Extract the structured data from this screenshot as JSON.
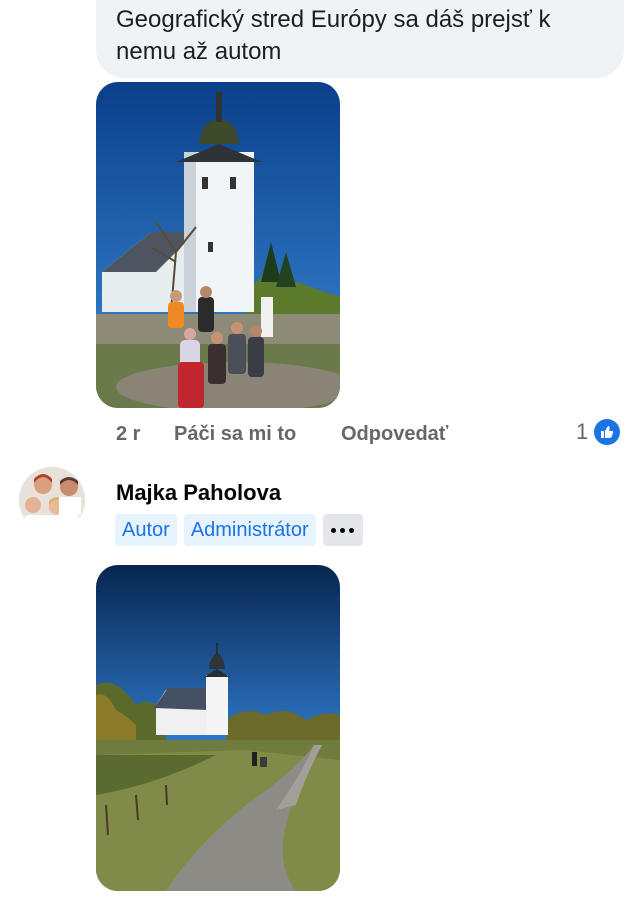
{
  "comment": {
    "text": "Geografický stred Európy sa dáš prejsť k nemu až autom",
    "time": "2 r",
    "like_label": "Páči sa mi to",
    "reply_label": "Odpovedať",
    "reaction_count": "1",
    "reaction_icon": "thumbs-up-icon"
  },
  "reply": {
    "author": "Majka Paholova",
    "badges": [
      "Autor",
      "Administrátor"
    ],
    "more_icon": "more-options-icon"
  },
  "colors": {
    "accent": "#1b74e4",
    "badge_bg": "#e7f3ff",
    "bubble_bg": "#f0f2f5",
    "meta_text": "#65676b"
  }
}
